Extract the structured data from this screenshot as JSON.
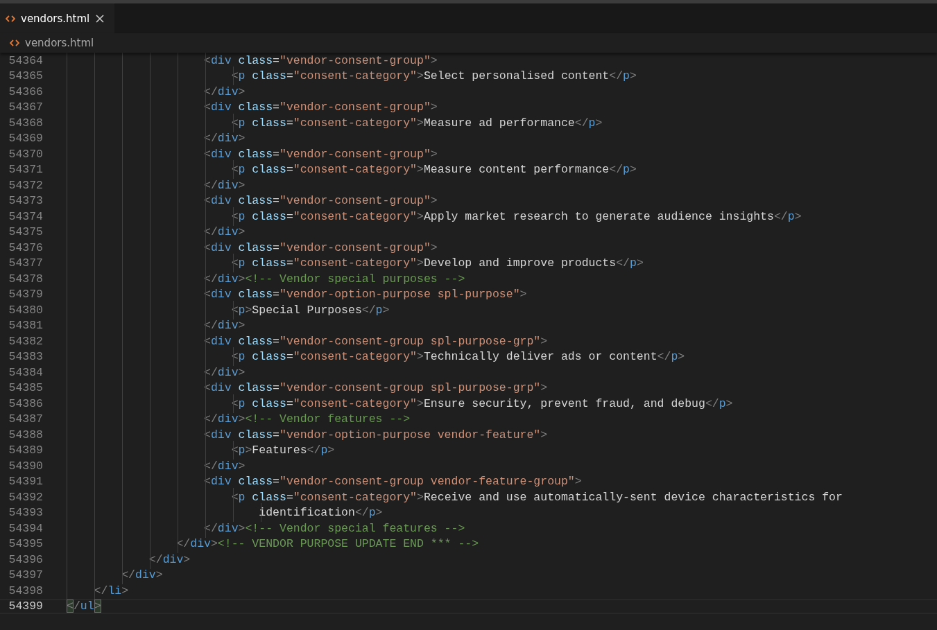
{
  "tabs": [
    {
      "label": "vendors.html",
      "selected": true
    }
  ],
  "breadcrumb": {
    "label": "vendors.html"
  },
  "editor": {
    "lines": [
      {
        "number": "54364",
        "current": false,
        "tokens": [
          {
            "kind": "punct",
            "text": "                    <"
          },
          {
            "kind": "tag",
            "text": "div"
          },
          {
            "kind": "attr",
            "text": " class"
          },
          {
            "kind": "op",
            "text": "="
          },
          {
            "kind": "string",
            "text": "\"vendor-consent-group\""
          },
          {
            "kind": "punct",
            "text": ">"
          }
        ]
      },
      {
        "number": "54365",
        "current": false,
        "tokens": [
          {
            "kind": "punct",
            "text": "                        <"
          },
          {
            "kind": "tag",
            "text": "p"
          },
          {
            "kind": "attr",
            "text": " class"
          },
          {
            "kind": "op",
            "text": "="
          },
          {
            "kind": "string",
            "text": "\"consent-category\""
          },
          {
            "kind": "punct",
            "text": ">"
          },
          {
            "kind": "text",
            "text": "Select personalised content"
          },
          {
            "kind": "punct",
            "text": "</"
          },
          {
            "kind": "tag",
            "text": "p"
          },
          {
            "kind": "punct",
            "text": ">"
          }
        ]
      },
      {
        "number": "54366",
        "current": false,
        "tokens": [
          {
            "kind": "punct",
            "text": "                    </"
          },
          {
            "kind": "tag",
            "text": "div"
          },
          {
            "kind": "punct",
            "text": ">"
          }
        ]
      },
      {
        "number": "54367",
        "current": false,
        "tokens": [
          {
            "kind": "punct",
            "text": "                    <"
          },
          {
            "kind": "tag",
            "text": "div"
          },
          {
            "kind": "attr",
            "text": " class"
          },
          {
            "kind": "op",
            "text": "="
          },
          {
            "kind": "string",
            "text": "\"vendor-consent-group\""
          },
          {
            "kind": "punct",
            "text": ">"
          }
        ]
      },
      {
        "number": "54368",
        "current": false,
        "tokens": [
          {
            "kind": "punct",
            "text": "                        <"
          },
          {
            "kind": "tag",
            "text": "p"
          },
          {
            "kind": "attr",
            "text": " class"
          },
          {
            "kind": "op",
            "text": "="
          },
          {
            "kind": "string",
            "text": "\"consent-category\""
          },
          {
            "kind": "punct",
            "text": ">"
          },
          {
            "kind": "text",
            "text": "Measure ad performance"
          },
          {
            "kind": "punct",
            "text": "</"
          },
          {
            "kind": "tag",
            "text": "p"
          },
          {
            "kind": "punct",
            "text": ">"
          }
        ]
      },
      {
        "number": "54369",
        "current": false,
        "tokens": [
          {
            "kind": "punct",
            "text": "                    </"
          },
          {
            "kind": "tag",
            "text": "div"
          },
          {
            "kind": "punct",
            "text": ">"
          }
        ]
      },
      {
        "number": "54370",
        "current": false,
        "tokens": [
          {
            "kind": "punct",
            "text": "                    <"
          },
          {
            "kind": "tag",
            "text": "div"
          },
          {
            "kind": "attr",
            "text": " class"
          },
          {
            "kind": "op",
            "text": "="
          },
          {
            "kind": "string",
            "text": "\"vendor-consent-group\""
          },
          {
            "kind": "punct",
            "text": ">"
          }
        ]
      },
      {
        "number": "54371",
        "current": false,
        "tokens": [
          {
            "kind": "punct",
            "text": "                        <"
          },
          {
            "kind": "tag",
            "text": "p"
          },
          {
            "kind": "attr",
            "text": " class"
          },
          {
            "kind": "op",
            "text": "="
          },
          {
            "kind": "string",
            "text": "\"consent-category\""
          },
          {
            "kind": "punct",
            "text": ">"
          },
          {
            "kind": "text",
            "text": "Measure content performance"
          },
          {
            "kind": "punct",
            "text": "</"
          },
          {
            "kind": "tag",
            "text": "p"
          },
          {
            "kind": "punct",
            "text": ">"
          }
        ]
      },
      {
        "number": "54372",
        "current": false,
        "tokens": [
          {
            "kind": "punct",
            "text": "                    </"
          },
          {
            "kind": "tag",
            "text": "div"
          },
          {
            "kind": "punct",
            "text": ">"
          }
        ]
      },
      {
        "number": "54373",
        "current": false,
        "tokens": [
          {
            "kind": "punct",
            "text": "                    <"
          },
          {
            "kind": "tag",
            "text": "div"
          },
          {
            "kind": "attr",
            "text": " class"
          },
          {
            "kind": "op",
            "text": "="
          },
          {
            "kind": "string",
            "text": "\"vendor-consent-group\""
          },
          {
            "kind": "punct",
            "text": ">"
          }
        ]
      },
      {
        "number": "54374",
        "current": false,
        "tokens": [
          {
            "kind": "punct",
            "text": "                        <"
          },
          {
            "kind": "tag",
            "text": "p"
          },
          {
            "kind": "attr",
            "text": " class"
          },
          {
            "kind": "op",
            "text": "="
          },
          {
            "kind": "string",
            "text": "\"consent-category\""
          },
          {
            "kind": "punct",
            "text": ">"
          },
          {
            "kind": "text",
            "text": "Apply market research to generate audience insights"
          },
          {
            "kind": "punct",
            "text": "</"
          },
          {
            "kind": "tag",
            "text": "p"
          },
          {
            "kind": "punct",
            "text": ">"
          }
        ]
      },
      {
        "number": "54375",
        "current": false,
        "tokens": [
          {
            "kind": "punct",
            "text": "                    </"
          },
          {
            "kind": "tag",
            "text": "div"
          },
          {
            "kind": "punct",
            "text": ">"
          }
        ]
      },
      {
        "number": "54376",
        "current": false,
        "tokens": [
          {
            "kind": "punct",
            "text": "                    <"
          },
          {
            "kind": "tag",
            "text": "div"
          },
          {
            "kind": "attr",
            "text": " class"
          },
          {
            "kind": "op",
            "text": "="
          },
          {
            "kind": "string",
            "text": "\"vendor-consent-group\""
          },
          {
            "kind": "punct",
            "text": ">"
          }
        ]
      },
      {
        "number": "54377",
        "current": false,
        "tokens": [
          {
            "kind": "punct",
            "text": "                        <"
          },
          {
            "kind": "tag",
            "text": "p"
          },
          {
            "kind": "attr",
            "text": " class"
          },
          {
            "kind": "op",
            "text": "="
          },
          {
            "kind": "string",
            "text": "\"consent-category\""
          },
          {
            "kind": "punct",
            "text": ">"
          },
          {
            "kind": "text",
            "text": "Develop and improve products"
          },
          {
            "kind": "punct",
            "text": "</"
          },
          {
            "kind": "tag",
            "text": "p"
          },
          {
            "kind": "punct",
            "text": ">"
          }
        ]
      },
      {
        "number": "54378",
        "current": false,
        "tokens": [
          {
            "kind": "punct",
            "text": "                    </"
          },
          {
            "kind": "tag",
            "text": "div"
          },
          {
            "kind": "punct",
            "text": ">"
          },
          {
            "kind": "comment",
            "text": "<!-- Vendor special purposes -->"
          }
        ]
      },
      {
        "number": "54379",
        "current": false,
        "tokens": [
          {
            "kind": "punct",
            "text": "                    <"
          },
          {
            "kind": "tag",
            "text": "div"
          },
          {
            "kind": "attr",
            "text": " class"
          },
          {
            "kind": "op",
            "text": "="
          },
          {
            "kind": "string",
            "text": "\"vendor-option-purpose spl-purpose\""
          },
          {
            "kind": "punct",
            "text": ">"
          }
        ]
      },
      {
        "number": "54380",
        "current": false,
        "tokens": [
          {
            "kind": "punct",
            "text": "                        <"
          },
          {
            "kind": "tag",
            "text": "p"
          },
          {
            "kind": "punct",
            "text": ">"
          },
          {
            "kind": "text",
            "text": "Special Purposes"
          },
          {
            "kind": "punct",
            "text": "</"
          },
          {
            "kind": "tag",
            "text": "p"
          },
          {
            "kind": "punct",
            "text": ">"
          }
        ]
      },
      {
        "number": "54381",
        "current": false,
        "tokens": [
          {
            "kind": "punct",
            "text": "                    </"
          },
          {
            "kind": "tag",
            "text": "div"
          },
          {
            "kind": "punct",
            "text": ">"
          }
        ]
      },
      {
        "number": "54382",
        "current": false,
        "tokens": [
          {
            "kind": "punct",
            "text": "                    <"
          },
          {
            "kind": "tag",
            "text": "div"
          },
          {
            "kind": "attr",
            "text": " class"
          },
          {
            "kind": "op",
            "text": "="
          },
          {
            "kind": "string",
            "text": "\"vendor-consent-group spl-purpose-grp\""
          },
          {
            "kind": "punct",
            "text": ">"
          }
        ]
      },
      {
        "number": "54383",
        "current": false,
        "tokens": [
          {
            "kind": "punct",
            "text": "                        <"
          },
          {
            "kind": "tag",
            "text": "p"
          },
          {
            "kind": "attr",
            "text": " class"
          },
          {
            "kind": "op",
            "text": "="
          },
          {
            "kind": "string",
            "text": "\"consent-category\""
          },
          {
            "kind": "punct",
            "text": ">"
          },
          {
            "kind": "text",
            "text": "Technically deliver ads or content"
          },
          {
            "kind": "punct",
            "text": "</"
          },
          {
            "kind": "tag",
            "text": "p"
          },
          {
            "kind": "punct",
            "text": ">"
          }
        ]
      },
      {
        "number": "54384",
        "current": false,
        "tokens": [
          {
            "kind": "punct",
            "text": "                    </"
          },
          {
            "kind": "tag",
            "text": "div"
          },
          {
            "kind": "punct",
            "text": ">"
          }
        ]
      },
      {
        "number": "54385",
        "current": false,
        "tokens": [
          {
            "kind": "punct",
            "text": "                    <"
          },
          {
            "kind": "tag",
            "text": "div"
          },
          {
            "kind": "attr",
            "text": " class"
          },
          {
            "kind": "op",
            "text": "="
          },
          {
            "kind": "string",
            "text": "\"vendor-consent-group spl-purpose-grp\""
          },
          {
            "kind": "punct",
            "text": ">"
          }
        ]
      },
      {
        "number": "54386",
        "current": false,
        "tokens": [
          {
            "kind": "punct",
            "text": "                        <"
          },
          {
            "kind": "tag",
            "text": "p"
          },
          {
            "kind": "attr",
            "text": " class"
          },
          {
            "kind": "op",
            "text": "="
          },
          {
            "kind": "string",
            "text": "\"consent-category\""
          },
          {
            "kind": "punct",
            "text": ">"
          },
          {
            "kind": "text",
            "text": "Ensure security, prevent fraud, and debug"
          },
          {
            "kind": "punct",
            "text": "</"
          },
          {
            "kind": "tag",
            "text": "p"
          },
          {
            "kind": "punct",
            "text": ">"
          }
        ]
      },
      {
        "number": "54387",
        "current": false,
        "tokens": [
          {
            "kind": "punct",
            "text": "                    </"
          },
          {
            "kind": "tag",
            "text": "div"
          },
          {
            "kind": "punct",
            "text": ">"
          },
          {
            "kind": "comment",
            "text": "<!-- Vendor features -->"
          }
        ]
      },
      {
        "number": "54388",
        "current": false,
        "tokens": [
          {
            "kind": "punct",
            "text": "                    <"
          },
          {
            "kind": "tag",
            "text": "div"
          },
          {
            "kind": "attr",
            "text": " class"
          },
          {
            "kind": "op",
            "text": "="
          },
          {
            "kind": "string",
            "text": "\"vendor-option-purpose vendor-feature\""
          },
          {
            "kind": "punct",
            "text": ">"
          }
        ]
      },
      {
        "number": "54389",
        "current": false,
        "tokens": [
          {
            "kind": "punct",
            "text": "                        <"
          },
          {
            "kind": "tag",
            "text": "p"
          },
          {
            "kind": "punct",
            "text": ">"
          },
          {
            "kind": "text",
            "text": "Features"
          },
          {
            "kind": "punct",
            "text": "</"
          },
          {
            "kind": "tag",
            "text": "p"
          },
          {
            "kind": "punct",
            "text": ">"
          }
        ]
      },
      {
        "number": "54390",
        "current": false,
        "tokens": [
          {
            "kind": "punct",
            "text": "                    </"
          },
          {
            "kind": "tag",
            "text": "div"
          },
          {
            "kind": "punct",
            "text": ">"
          }
        ]
      },
      {
        "number": "54391",
        "current": false,
        "tokens": [
          {
            "kind": "punct",
            "text": "                    <"
          },
          {
            "kind": "tag",
            "text": "div"
          },
          {
            "kind": "attr",
            "text": " class"
          },
          {
            "kind": "op",
            "text": "="
          },
          {
            "kind": "string",
            "text": "\"vendor-consent-group vendor-feature-group\""
          },
          {
            "kind": "punct",
            "text": ">"
          }
        ]
      },
      {
        "number": "54392",
        "current": false,
        "tokens": [
          {
            "kind": "punct",
            "text": "                        <"
          },
          {
            "kind": "tag",
            "text": "p"
          },
          {
            "kind": "attr",
            "text": " class"
          },
          {
            "kind": "op",
            "text": "="
          },
          {
            "kind": "string",
            "text": "\"consent-category\""
          },
          {
            "kind": "punct",
            "text": ">"
          },
          {
            "kind": "text",
            "text": "Receive and use automatically-sent device characteristics for"
          }
        ]
      },
      {
        "number": "54393",
        "current": false,
        "tokens": [
          {
            "kind": "text",
            "text": "                            identification"
          },
          {
            "kind": "punct",
            "text": "</"
          },
          {
            "kind": "tag",
            "text": "p"
          },
          {
            "kind": "punct",
            "text": ">"
          }
        ]
      },
      {
        "number": "54394",
        "current": false,
        "tokens": [
          {
            "kind": "punct",
            "text": "                    </"
          },
          {
            "kind": "tag",
            "text": "div"
          },
          {
            "kind": "punct",
            "text": ">"
          },
          {
            "kind": "comment",
            "text": "<!-- Vendor special features -->"
          }
        ]
      },
      {
        "number": "54395",
        "current": false,
        "tokens": [
          {
            "kind": "punct",
            "text": "                </"
          },
          {
            "kind": "tag",
            "text": "div"
          },
          {
            "kind": "punct",
            "text": ">"
          },
          {
            "kind": "comment",
            "text": "<!-- VENDOR PURPOSE UPDATE END *** -->"
          }
        ]
      },
      {
        "number": "54396",
        "current": false,
        "tokens": [
          {
            "kind": "punct",
            "text": "            </"
          },
          {
            "kind": "tag",
            "text": "div"
          },
          {
            "kind": "punct",
            "text": ">"
          }
        ]
      },
      {
        "number": "54397",
        "current": false,
        "tokens": [
          {
            "kind": "punct",
            "text": "        </"
          },
          {
            "kind": "tag",
            "text": "div"
          },
          {
            "kind": "punct",
            "text": ">"
          }
        ]
      },
      {
        "number": "54398",
        "current": false,
        "tokens": [
          {
            "kind": "punct",
            "text": "    </"
          },
          {
            "kind": "tag",
            "text": "li"
          },
          {
            "kind": "punct",
            "text": ">"
          }
        ]
      },
      {
        "number": "54399",
        "current": true,
        "tokens": [
          {
            "kind": "match",
            "text": "<"
          },
          {
            "kind": "punct",
            "text": "/"
          },
          {
            "kind": "tag",
            "text": "ul"
          },
          {
            "kind": "match",
            "text": ">"
          }
        ]
      }
    ]
  }
}
